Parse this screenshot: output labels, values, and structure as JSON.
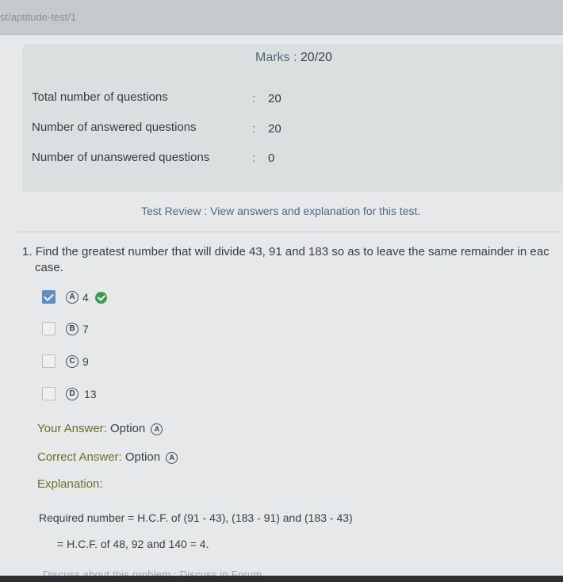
{
  "browser": {
    "url": "st/aptitude-test/1"
  },
  "summary": {
    "marks_label": "Marks : ",
    "marks_value": "20/20",
    "rows": [
      {
        "label": "Total number of questions",
        "colon": ":",
        "value": "20"
      },
      {
        "label": "Number of answered questions",
        "colon": ":",
        "value": "20"
      },
      {
        "label": "Number of unanswered questions",
        "colon": ":",
        "value": "0"
      }
    ]
  },
  "review_heading": "Test Review : View answers and explanation for this test.",
  "question": {
    "number": "1.",
    "text_line1": "Find the greatest number that will divide 43, 91 and 183 so as to leave the same remainder in eac",
    "text_line2": "case.",
    "options": [
      {
        "letter": "A",
        "value": "4",
        "checked": true,
        "correct": true
      },
      {
        "letter": "B",
        "value": "7",
        "checked": false,
        "correct": false
      },
      {
        "letter": "C",
        "value": "9",
        "checked": false,
        "correct": false
      },
      {
        "letter": "D",
        "value": "13",
        "checked": false,
        "correct": false
      }
    ],
    "your_answer_label": "Your Answer:",
    "your_answer_option_label": "Option",
    "your_answer_letter": "A",
    "correct_answer_label": "Correct Answer:",
    "correct_answer_option_label": "Option",
    "correct_answer_letter": "A",
    "explanation_label": "Explanation:",
    "solution_line1": "Required number = H.C.F. of (91 - 43), (183 - 91) and (183 - 43)",
    "solution_line2": "= H.C.F. of 48, 92 and 140 = 4."
  },
  "footer": {
    "discuss_problem": "Discuss about this problem",
    "separator": ":",
    "discuss_forum": "Discuss in Forum"
  },
  "colors": {
    "checked_box": "#5b8fc9",
    "correct_icon": "#3b9a4b",
    "answer_label": "#6b6f2c",
    "review_heading": "#4d6a80"
  }
}
